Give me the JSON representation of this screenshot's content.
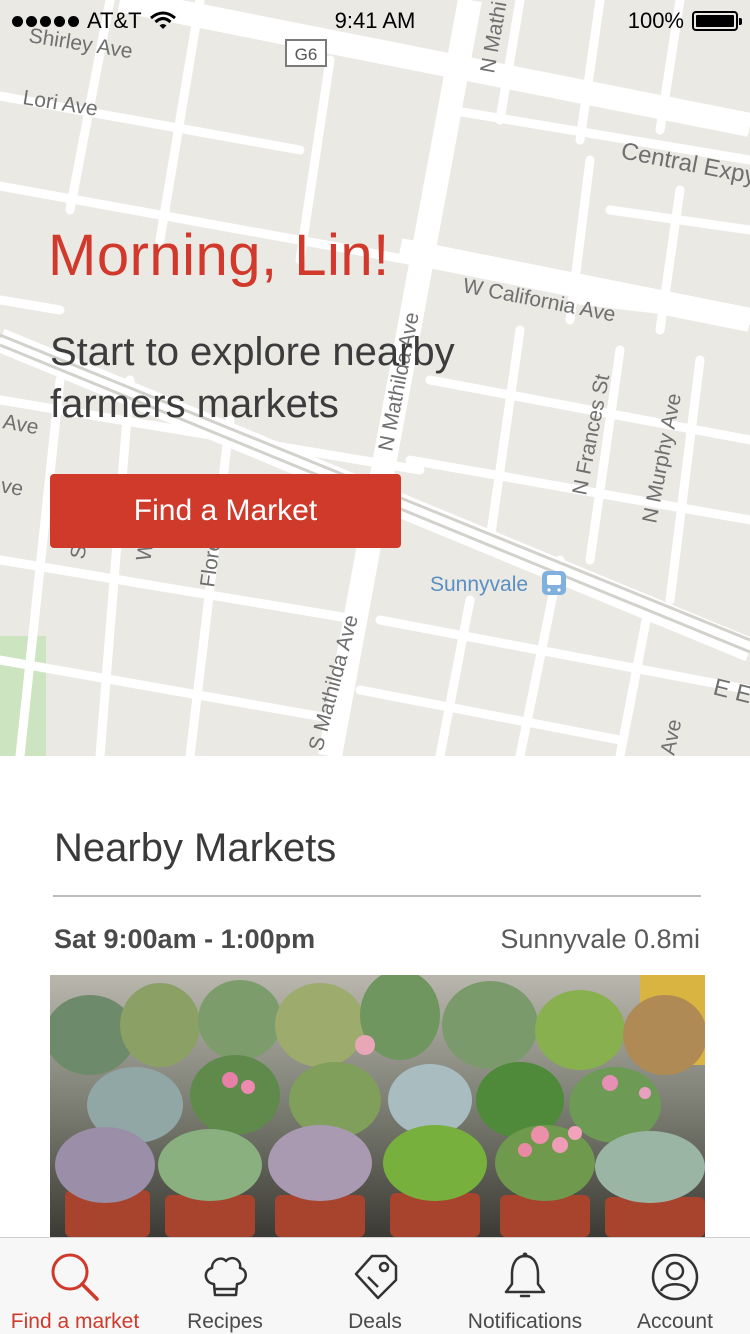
{
  "status_bar": {
    "carrier": "AT&T",
    "time": "9:41 AM",
    "battery": "100%"
  },
  "map": {
    "street_labels": {
      "shirley": "Shirley Ave",
      "lori": "Lori Ave",
      "g6": "G6",
      "n_mathilda_top": "N Mathi",
      "central": "Central Expy",
      "w_california": "W California Ave",
      "n_mathilda_mid": "N Mathilda Ave",
      "n_frances": "N Frances St",
      "n_murphy": "N Murphy Ave",
      "ave_left": "Ave",
      "ve_left": "ve",
      "s_ave": "S a Ave",
      "w_st": "W t",
      "flore": "Flore",
      "s_mathilda": "S Mathilda Ave",
      "ee": "E E",
      "ave_bottom": "Ave",
      "sunnyvale": "Sunnyvale"
    }
  },
  "hero": {
    "greeting": "Morning, Lin!",
    "subtitle": "Start to explore nearby farmers markets",
    "button_label": "Find a Market"
  },
  "nearby": {
    "title": "Nearby Markets",
    "markets": [
      {
        "time": "Sat 9:00am - 1:00pm",
        "location": "Sunnyvale 0.8mi"
      }
    ]
  },
  "tab_bar": {
    "tabs": [
      {
        "label": "Find a market",
        "icon": "search-icon",
        "active": true
      },
      {
        "label": "Recipes",
        "icon": "chef-hat-icon",
        "active": false
      },
      {
        "label": "Deals",
        "icon": "tag-icon",
        "active": false
      },
      {
        "label": "Notifications",
        "icon": "bell-icon",
        "active": false
      },
      {
        "label": "Account",
        "icon": "user-icon",
        "active": false
      }
    ]
  },
  "colors": {
    "accent": "#cf3a2b",
    "map_background": "#ebe9e4",
    "road": "#ffffff",
    "transit_label": "#5a8fc4"
  }
}
